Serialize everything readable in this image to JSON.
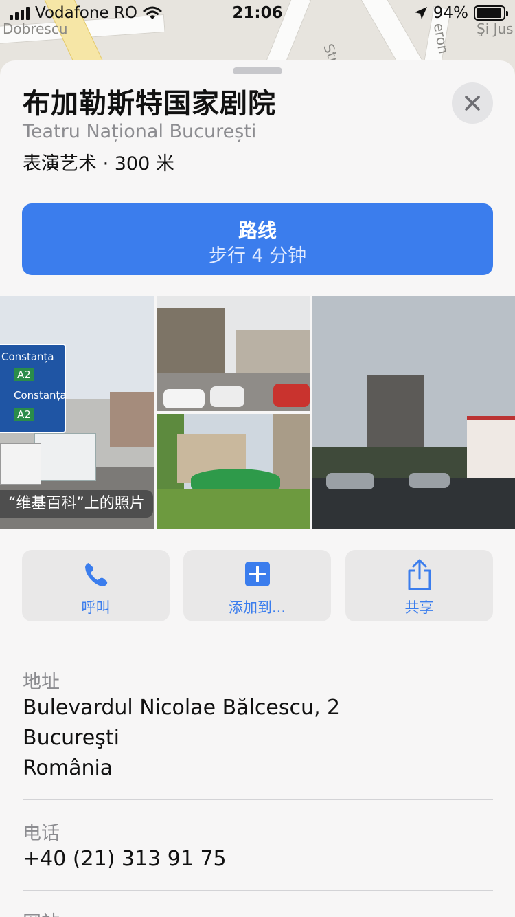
{
  "status_bar": {
    "carrier": "Vodafone RO",
    "time": "21:06",
    "battery": "94%",
    "battery_level": 0.94
  },
  "map": {
    "street_labels": [
      "Dobrescu",
      "Str",
      "eron",
      "Şi Jus"
    ]
  },
  "place": {
    "title": "布加勒斯特国家剧院",
    "subtitle": "Teatru Național București",
    "meta": "表演艺术 · 300 米"
  },
  "route_button": {
    "label": "路线",
    "detail": "步行 4 分钟"
  },
  "photos": {
    "credit": "“维基百科”上的照片",
    "sign_texts": [
      "Constanța",
      "A2",
      "Constanța",
      "A2"
    ]
  },
  "actions": [
    {
      "label": "呼叫",
      "icon": "phone-icon"
    },
    {
      "label": "添加到...",
      "icon": "plus-square-icon"
    },
    {
      "label": "共享",
      "icon": "share-icon"
    }
  ],
  "address": {
    "label": "地址",
    "line1": "Bulevardul Nicolae Bălcescu, 2",
    "line2": "Bucureşti",
    "line3": "România"
  },
  "phone": {
    "label": "电话",
    "value": "+40 (21) 313 91 75"
  },
  "website": {
    "label": "网站"
  },
  "colors": {
    "accent": "#3b7ded",
    "sheet_background": "#f7f6f6",
    "secondary_text": "#8c8c90"
  }
}
